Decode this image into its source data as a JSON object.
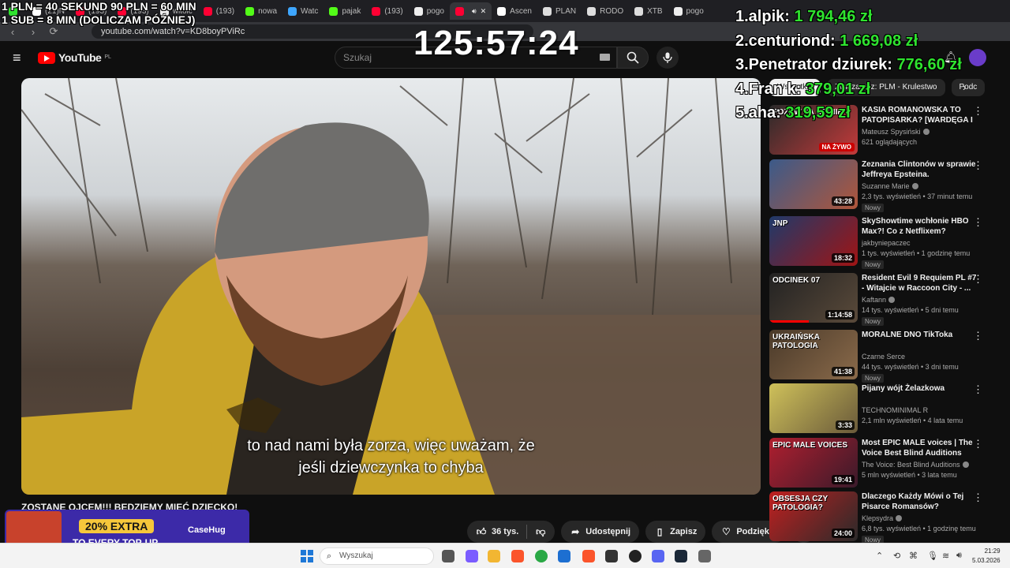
{
  "browser": {
    "tabs": [
      {
        "label": "",
        "color": "#2fe32f"
      },
      {
        "label": "(21)N",
        "color": "#ffffff"
      },
      {
        "label": "(193)",
        "color": "#ff0033"
      },
      {
        "label": "(193)",
        "color": "#ff0033"
      },
      {
        "label": "witolc",
        "color": "#eeeeee"
      },
      {
        "label": "(193)",
        "color": "#ff0033"
      },
      {
        "label": "nowa",
        "color": "#53fc18"
      },
      {
        "label": "Watc",
        "color": "#3ea6ff"
      },
      {
        "label": "pajak",
        "color": "#53fc18"
      },
      {
        "label": "(193)",
        "color": "#ff0033"
      },
      {
        "label": "pogo",
        "color": "#eeeeee"
      },
      {
        "label": "",
        "color": "#ff0033",
        "active": true
      },
      {
        "label": "Ascen",
        "color": "#ffffff"
      },
      {
        "label": "PLAN",
        "color": "#dddddd"
      },
      {
        "label": "RODO",
        "color": "#dddddd"
      },
      {
        "label": "XTB",
        "color": "#dddddd"
      },
      {
        "label": "pogo",
        "color": "#eeeeee"
      }
    ],
    "url": "youtube.com/watch?v=KD8boyPViRc"
  },
  "youtube": {
    "logo": "YouTube",
    "logo_region": "PL",
    "search_placeholder": "Szukaj",
    "video_subtitle_line1": "to nad nami była zorza, więc uważam, że",
    "video_subtitle_line2": "jeśli dziewczynka to chyba",
    "video_title": "ZOSTANĘ OJCEM!!! BĘDZIEMY MIEĆ DZIECKO!",
    "actions": {
      "likes": "36 tys.",
      "share": "Udostępnij",
      "save": "Zapisz",
      "thanks": "Podziękuj",
      "more": "⋯"
    },
    "chips": [
      "Wszystkie",
      "Związane z: PLM - Krulestwo",
      "Podc"
    ],
    "recommendations": [
      {
        "title": "KASIA ROMANOWSKA TO PATOPISARKA? [WARDĘGA I ...",
        "channel": "Mateusz Spysiński",
        "verified": true,
        "meta": "621 oglądających",
        "thumb_text": "POZEW ZA OPINIE",
        "live": "NA ŻYWO",
        "badge": "",
        "thumb_colors": [
          "#2a2a2a",
          "#c43a3a"
        ]
      },
      {
        "title": "Zeznania Clintonów w sprawie Jeffreya Epsteina.",
        "channel": "Suzanne Marie",
        "verified": true,
        "meta": "2,3 tys. wyświetleń • 37 minut temu",
        "duration": "43:28",
        "badge": "Nowy",
        "thumb_colors": [
          "#3b5a8a",
          "#b0563a"
        ]
      },
      {
        "title": "SkyShowtime wchłonie HBO Max?! Co z Netflixem?",
        "channel": "jakbyniepaczec",
        "verified": false,
        "meta": "1 tys. wyświetleń • 1 godzinę temu",
        "duration": "18:32",
        "badge": "Nowy",
        "thumb_text": "JNP",
        "thumb_colors": [
          "#1f3a6a",
          "#a01414"
        ]
      },
      {
        "title": "Resident Evil 9 Requiem PL #7 - Witajcie w Raccoon City - ...",
        "channel": "Kaftann",
        "verified": true,
        "meta": "14 tys. wyświetleń • 5 dni temu",
        "duration": "1:14:58",
        "badge": "Nowy",
        "thumb_text": "ODCINEK 07",
        "progress": 0.45,
        "thumb_colors": [
          "#222222",
          "#5a4a3a"
        ]
      },
      {
        "title": "MORALNE DNO TikToka",
        "channel": "Czarne Serce",
        "verified": false,
        "meta": "44 tys. wyświetleń • 3 dni temu",
        "duration": "41:38",
        "badge": "Nowy",
        "thumb_text": "UKRAIŃSKA PATOLOGIA",
        "thumb_colors": [
          "#4a3a2a",
          "#8a6a4a"
        ]
      },
      {
        "title": "Pijany wójt Żelazkowa",
        "channel": "TECHNOMINIMAL R",
        "verified": false,
        "meta": "2,1 mln wyświetleń • 4 lata temu",
        "duration": "3:33",
        "badge": "",
        "thumb_colors": [
          "#cfc15a",
          "#6a5a3a"
        ]
      },
      {
        "title": "Most EPIC MALE voices | The Voice Best Blind Auditions",
        "channel": "The Voice: Best Blind Auditions",
        "verified": true,
        "meta": "5 mln wyświetleń • 3 lata temu",
        "duration": "19:41",
        "badge": "",
        "thumb_text": "EPIC MALE VOICES",
        "thumb_colors": [
          "#b01f2f",
          "#3a1a2a"
        ]
      },
      {
        "title": "Dlaczego Każdy Mówi o Tej Pisarce Romansów? (Katarzyn...",
        "channel": "Klepsydra",
        "verified": true,
        "meta": "6,8 tys. wyświetleń • 1 godzinę temu",
        "duration": "24:00",
        "badge": "Nowy",
        "thumb_text": "OBSESJA CZY PATOLOGIA?",
        "thumb_colors": [
          "#c02020",
          "#2a2a2a"
        ]
      }
    ]
  },
  "overlay": {
    "rule1": "1 PLN =  40 SEKUND 90 PLN = 60 MIN",
    "rule2": "1 SUB = 8 MIN (DOLICZAM PÓŹNIEJ)",
    "timer": "125:57:24",
    "leaderboard": [
      {
        "name": "1.alpik: ",
        "amount": "1 794,46 zł"
      },
      {
        "name": "2.centuriond: ",
        "amount": "1 669,08 zł"
      },
      {
        "name": "3.Penetrator dziurek: ",
        "amount": "776,60 zł"
      },
      {
        "name": "4.Fran k: ",
        "amount": "379,01 zł"
      },
      {
        "name": "5.aha: ",
        "amount": "319,59 zł"
      }
    ]
  },
  "promo": {
    "line1": "20% EXTRA",
    "line2": "TO EVERY TOP-UP",
    "brand": "CaseHug"
  },
  "taskbar": {
    "search_placeholder": "Wyszukaj",
    "time": "21:29",
    "date": "5.03.2026"
  }
}
